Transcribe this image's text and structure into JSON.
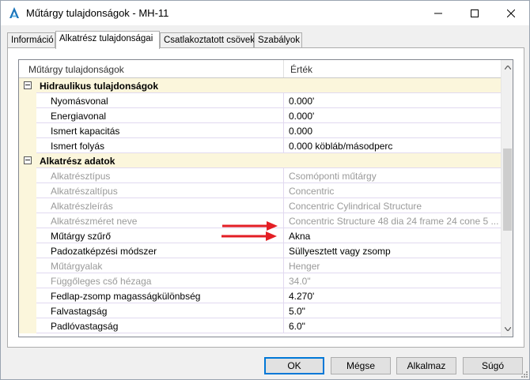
{
  "window": {
    "title": "Műtárgy tulajdonságok - MH-11",
    "controls": {
      "minimize": "minimize",
      "maximize": "maximize",
      "close": "close"
    }
  },
  "tabs": [
    {
      "label": "Információ",
      "active": false
    },
    {
      "label": "Alkatrész tulajdonságai",
      "active": true
    },
    {
      "label": "Csatlakoztatott csövek",
      "active": false
    },
    {
      "label": "Szabályok",
      "active": false
    }
  ],
  "grid": {
    "headers": {
      "property": "Műtárgy tulajdonságok",
      "value": "Érték"
    },
    "rows": [
      {
        "kind": "category",
        "name": "Hidraulikus tulajdonságok",
        "value": ""
      },
      {
        "kind": "item",
        "name": "Nyomásvonal",
        "value": "0.000'",
        "disabled": false
      },
      {
        "kind": "item",
        "name": "Energiavonal",
        "value": "0.000'",
        "disabled": false
      },
      {
        "kind": "item",
        "name": "Ismert kapacitás",
        "value": "0.000",
        "disabled": false
      },
      {
        "kind": "item",
        "name": "Ismert folyás",
        "value": "0.000 köbláb/másodperc",
        "disabled": false
      },
      {
        "kind": "category",
        "name": "Alkatrész adatok",
        "value": ""
      },
      {
        "kind": "item",
        "name": "Alkatrésztípus",
        "value": "Csomóponti műtárgy",
        "disabled": true
      },
      {
        "kind": "item",
        "name": "Alkatrészaltípus",
        "value": "Concentric",
        "disabled": true
      },
      {
        "kind": "item",
        "name": "Alkatrészleírás",
        "value": "Concentric Cylindrical Structure",
        "disabled": true
      },
      {
        "kind": "item",
        "name": "Alkatrészméret neve",
        "value": "Concentric Structure 48 dia 24 frame 24 cone 5 ...",
        "disabled": true
      },
      {
        "kind": "item",
        "name": "Műtárgy szűrő",
        "value": "Akna",
        "disabled": false
      },
      {
        "kind": "item",
        "name": "Padozatképzési módszer",
        "value": "Süllyesztett vagy zsomp",
        "disabled": false
      },
      {
        "kind": "item",
        "name": "Műtárgyalak",
        "value": "Henger",
        "disabled": true
      },
      {
        "kind": "item",
        "name": "Függőleges cső hézaga",
        "value": "34.0\"",
        "disabled": true
      },
      {
        "kind": "item",
        "name": "Fedlap-zsomp magasságkülönbség",
        "value": "4.270'",
        "disabled": false
      },
      {
        "kind": "item",
        "name": "Falvastagság",
        "value": "5.0\"",
        "disabled": false
      },
      {
        "kind": "item",
        "name": "Padlóvastagság",
        "value": "6.0\"",
        "disabled": false
      }
    ],
    "scroll_position": 0.45
  },
  "annotations": {
    "arrow_color": "#e31e24"
  },
  "buttons": {
    "ok": "OK",
    "cancel": "Mégse",
    "apply": "Alkalmaz",
    "help": "Súgó"
  },
  "colors": {
    "accent": "#0078d7",
    "category_bg": "#fbf6dc",
    "grid_line": "#e1d9f0",
    "disabled_text": "#9a9a9a"
  }
}
